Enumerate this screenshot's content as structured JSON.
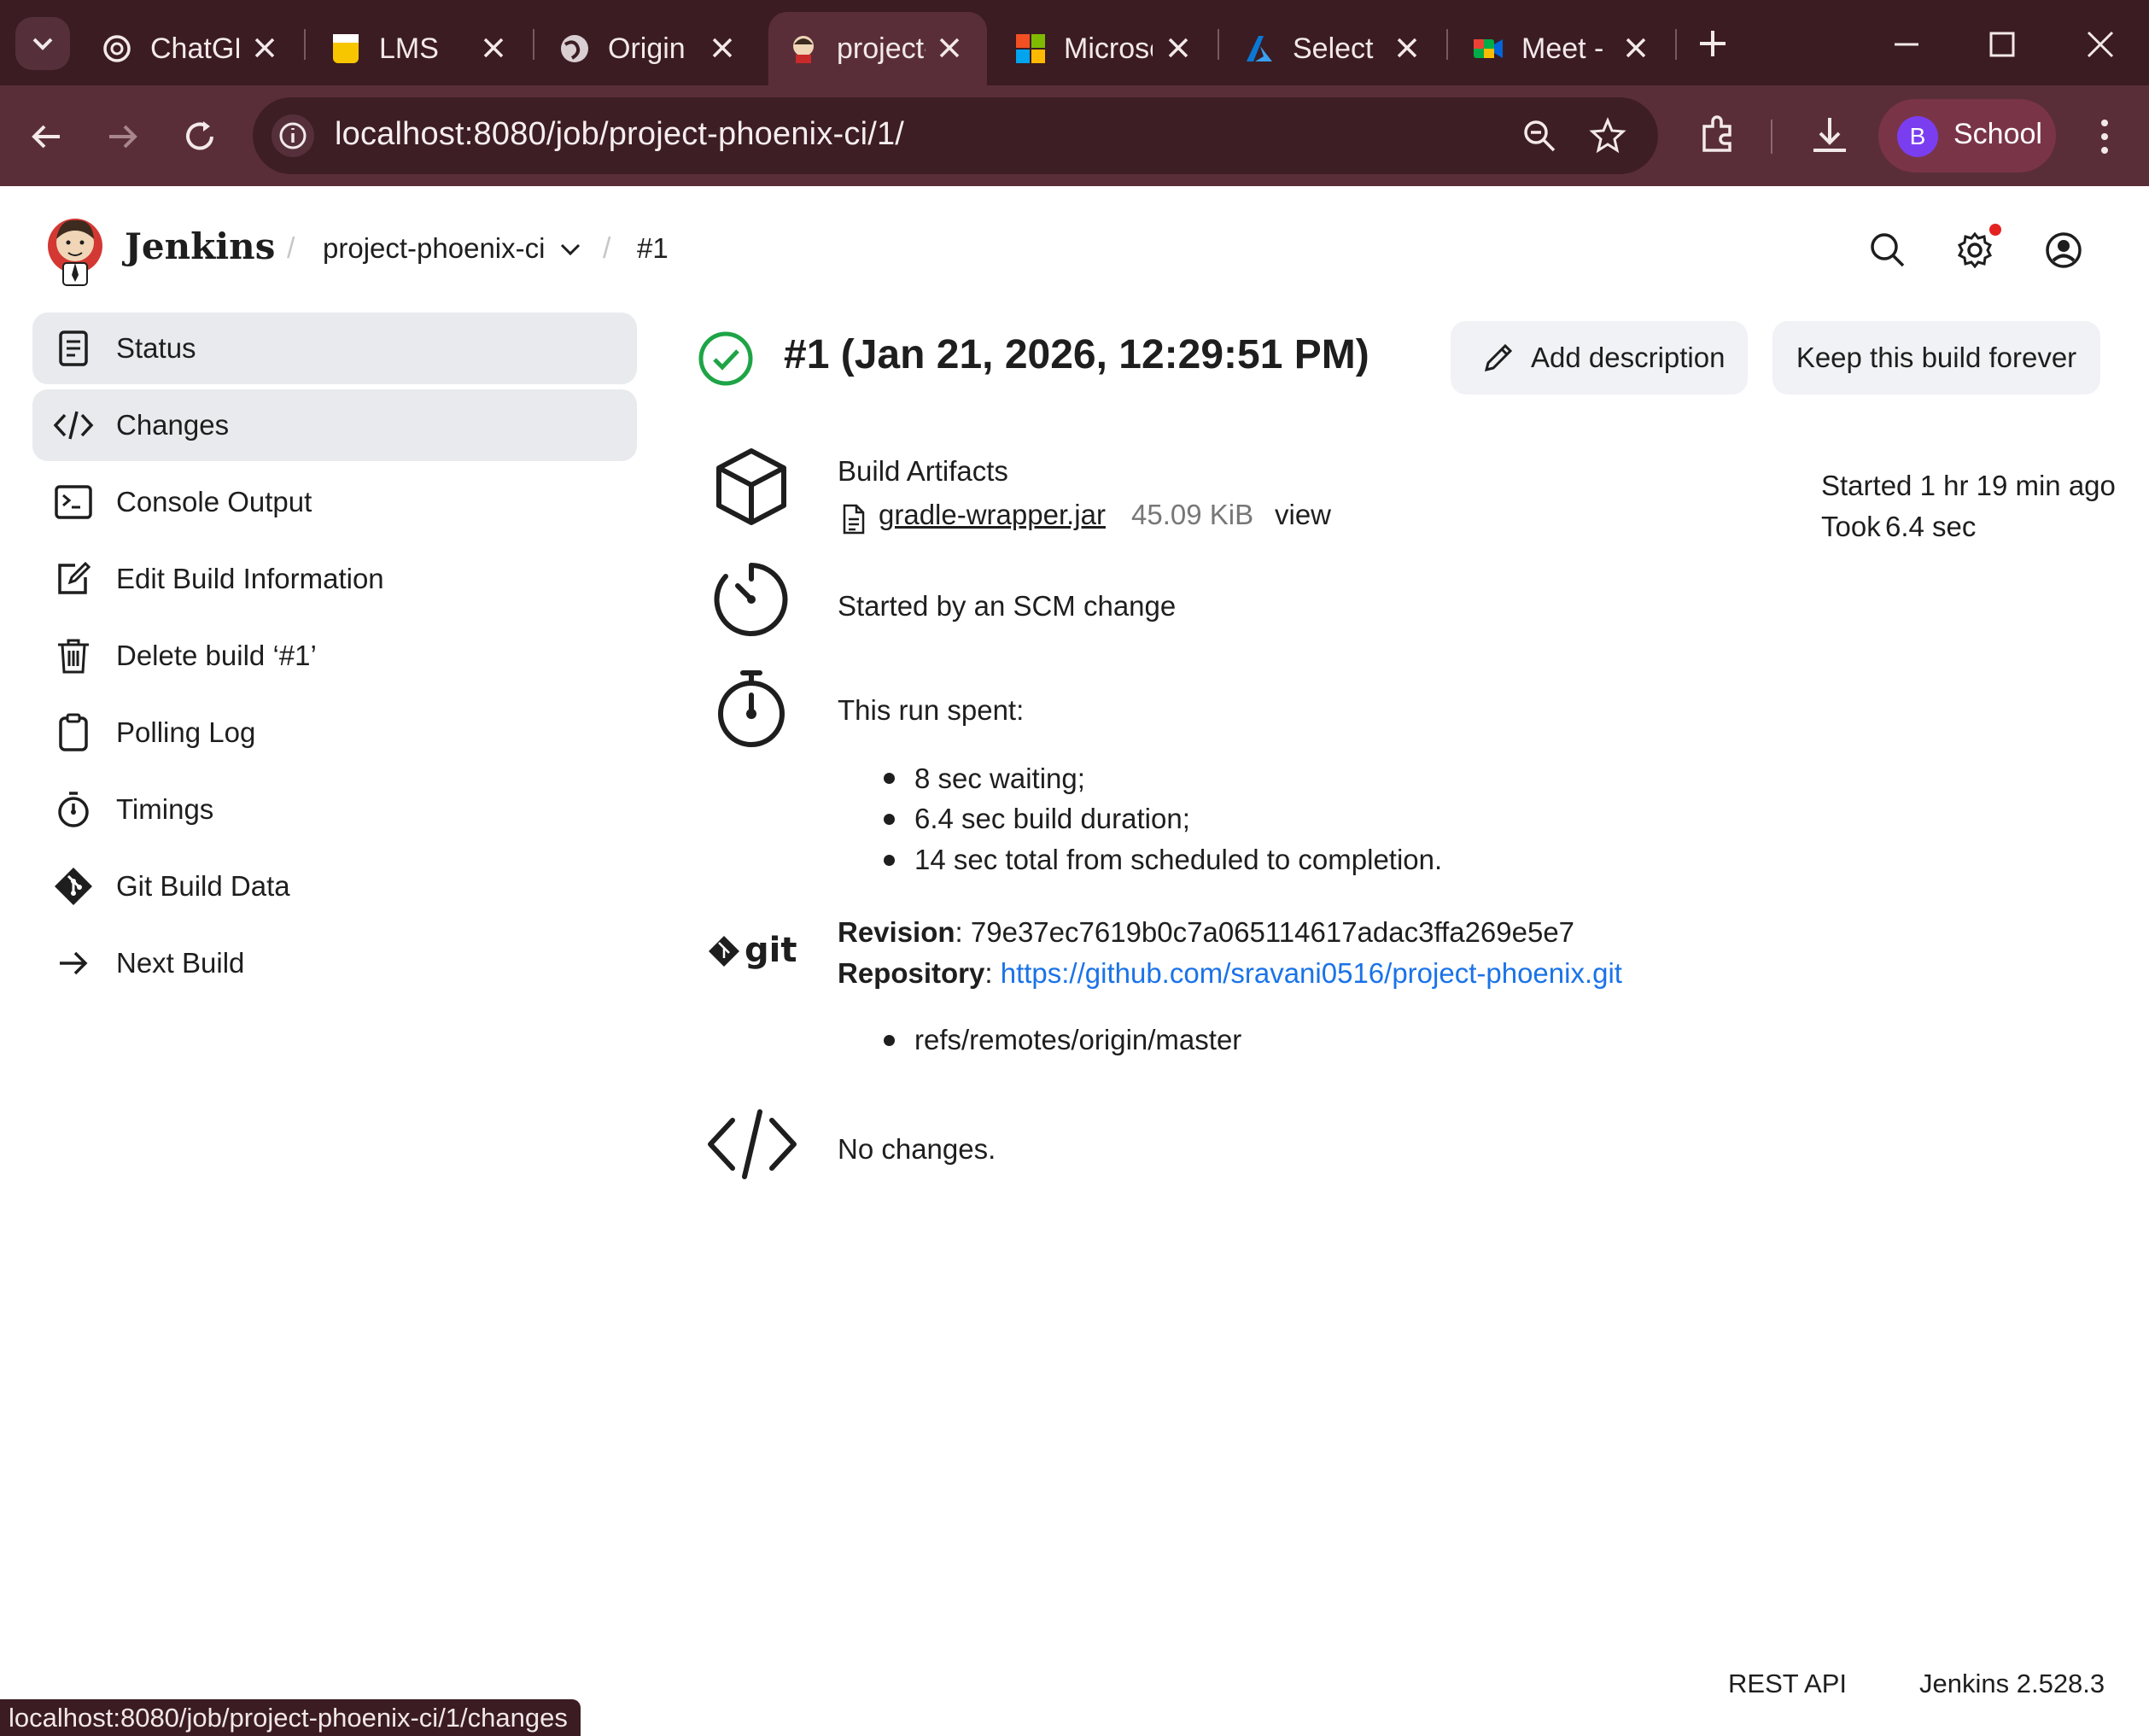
{
  "browser": {
    "tabs": [
      {
        "title": "ChatGPT",
        "icon": "openai-icon"
      },
      {
        "title": "LMS",
        "icon": "lms-icon"
      },
      {
        "title": "Origin",
        "icon": "globe-icon"
      },
      {
        "title": "project-phoenix-ci",
        "icon": "jenkins-icon",
        "active": true
      },
      {
        "title": "Microsoft",
        "icon": "microsoft-icon"
      },
      {
        "title": "Select",
        "icon": "azure-icon"
      },
      {
        "title": "Meet -",
        "icon": "meet-icon"
      }
    ],
    "url": "localhost:8080/job/project-phoenix-ci/1/",
    "profile": {
      "initial": "B",
      "name": "School"
    },
    "status_url": "localhost:8080/job/project-phoenix-ci/1/changes"
  },
  "header": {
    "brand": "Jenkins",
    "breadcrumb": [
      "project-phoenix-ci",
      "#1"
    ]
  },
  "sidebar": {
    "items": [
      {
        "label": "Status",
        "icon": "status-icon"
      },
      {
        "label": "Changes",
        "icon": "code-icon"
      },
      {
        "label": "Console Output",
        "icon": "terminal-icon"
      },
      {
        "label": "Edit Build Information",
        "icon": "edit-icon"
      },
      {
        "label": "Delete build ‘#1’",
        "icon": "trash-icon"
      },
      {
        "label": "Polling Log",
        "icon": "clipboard-icon"
      },
      {
        "label": "Timings",
        "icon": "stopwatch-icon"
      },
      {
        "label": "Git Build Data",
        "icon": "git-icon"
      },
      {
        "label": "Next Build",
        "icon": "arrow-right-icon"
      }
    ]
  },
  "build": {
    "title": "#1 (Jan 21, 2026, 12:29:51 PM)",
    "status_color": "#1ea446",
    "add_description": "Add description",
    "keep_forever": "Keep this build forever",
    "started": "Started 1 hr 19 min ago",
    "took_prefix": "Took",
    "took_value": "6.4 sec",
    "artifacts": {
      "heading": "Build Artifacts",
      "file": "gradle-wrapper.jar",
      "size": "45.09 KiB",
      "view": "view"
    },
    "cause": "Started by an SCM change",
    "timing": {
      "heading": "This run spent:",
      "items": [
        "8 sec waiting;",
        "6.4 sec build duration;",
        "14 sec total from scheduled to completion."
      ]
    },
    "git": {
      "revision_label": "Revision",
      "revision": "79e37ec7619b0c7a065114617adac3ffa269e5e7",
      "repository_label": "Repository",
      "repository": "https://github.com/sravani0516/project-phoenix.git",
      "branch": "refs/remotes/origin/master"
    },
    "changes": "No changes."
  },
  "footer": {
    "rest_api": "REST API",
    "version": "Jenkins 2.528.3"
  },
  "colors": {
    "link": "#1a73e8",
    "browser_frame": "#3b1c22",
    "browser_toolbar": "#5a2e38"
  }
}
